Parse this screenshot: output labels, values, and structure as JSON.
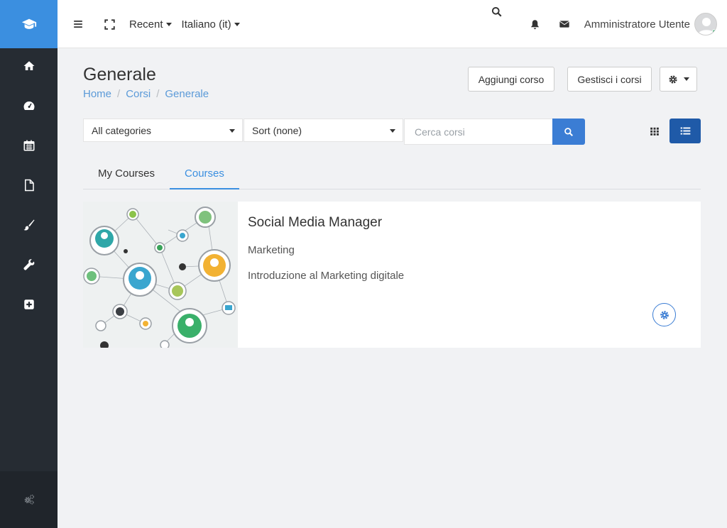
{
  "topbar": {
    "recent": "Recent",
    "language": "Italiano (it)",
    "user_name": "Amministratore Utente"
  },
  "page": {
    "title": "Generale",
    "breadcrumb": [
      "Home",
      "Corsi",
      "Generale"
    ]
  },
  "actions": {
    "add_course": "Aggiungi corso",
    "manage_courses": "Gestisci i corsi"
  },
  "filters": {
    "category": "All categories",
    "sort": "Sort (none)",
    "search_placeholder": "Cerca corsi"
  },
  "tabs": [
    {
      "label": "My Courses",
      "active": false
    },
    {
      "label": "Courses",
      "active": true
    }
  ],
  "course": {
    "title": "Social Media Manager",
    "category": "Marketing",
    "summary": "Introduzione al Marketing digitale"
  },
  "sidebar": {
    "items": [
      "home-icon",
      "dashboard-icon",
      "calendar-icon",
      "file-icon",
      "brush-icon",
      "wrench-icon",
      "plus-square-icon"
    ],
    "bottom": "cogs-icon"
  },
  "colors": {
    "brand": "#3b8fe0",
    "sidebar": "#262c33",
    "primary_button": "#3b7dd4",
    "active_view": "#1f5aa8"
  }
}
